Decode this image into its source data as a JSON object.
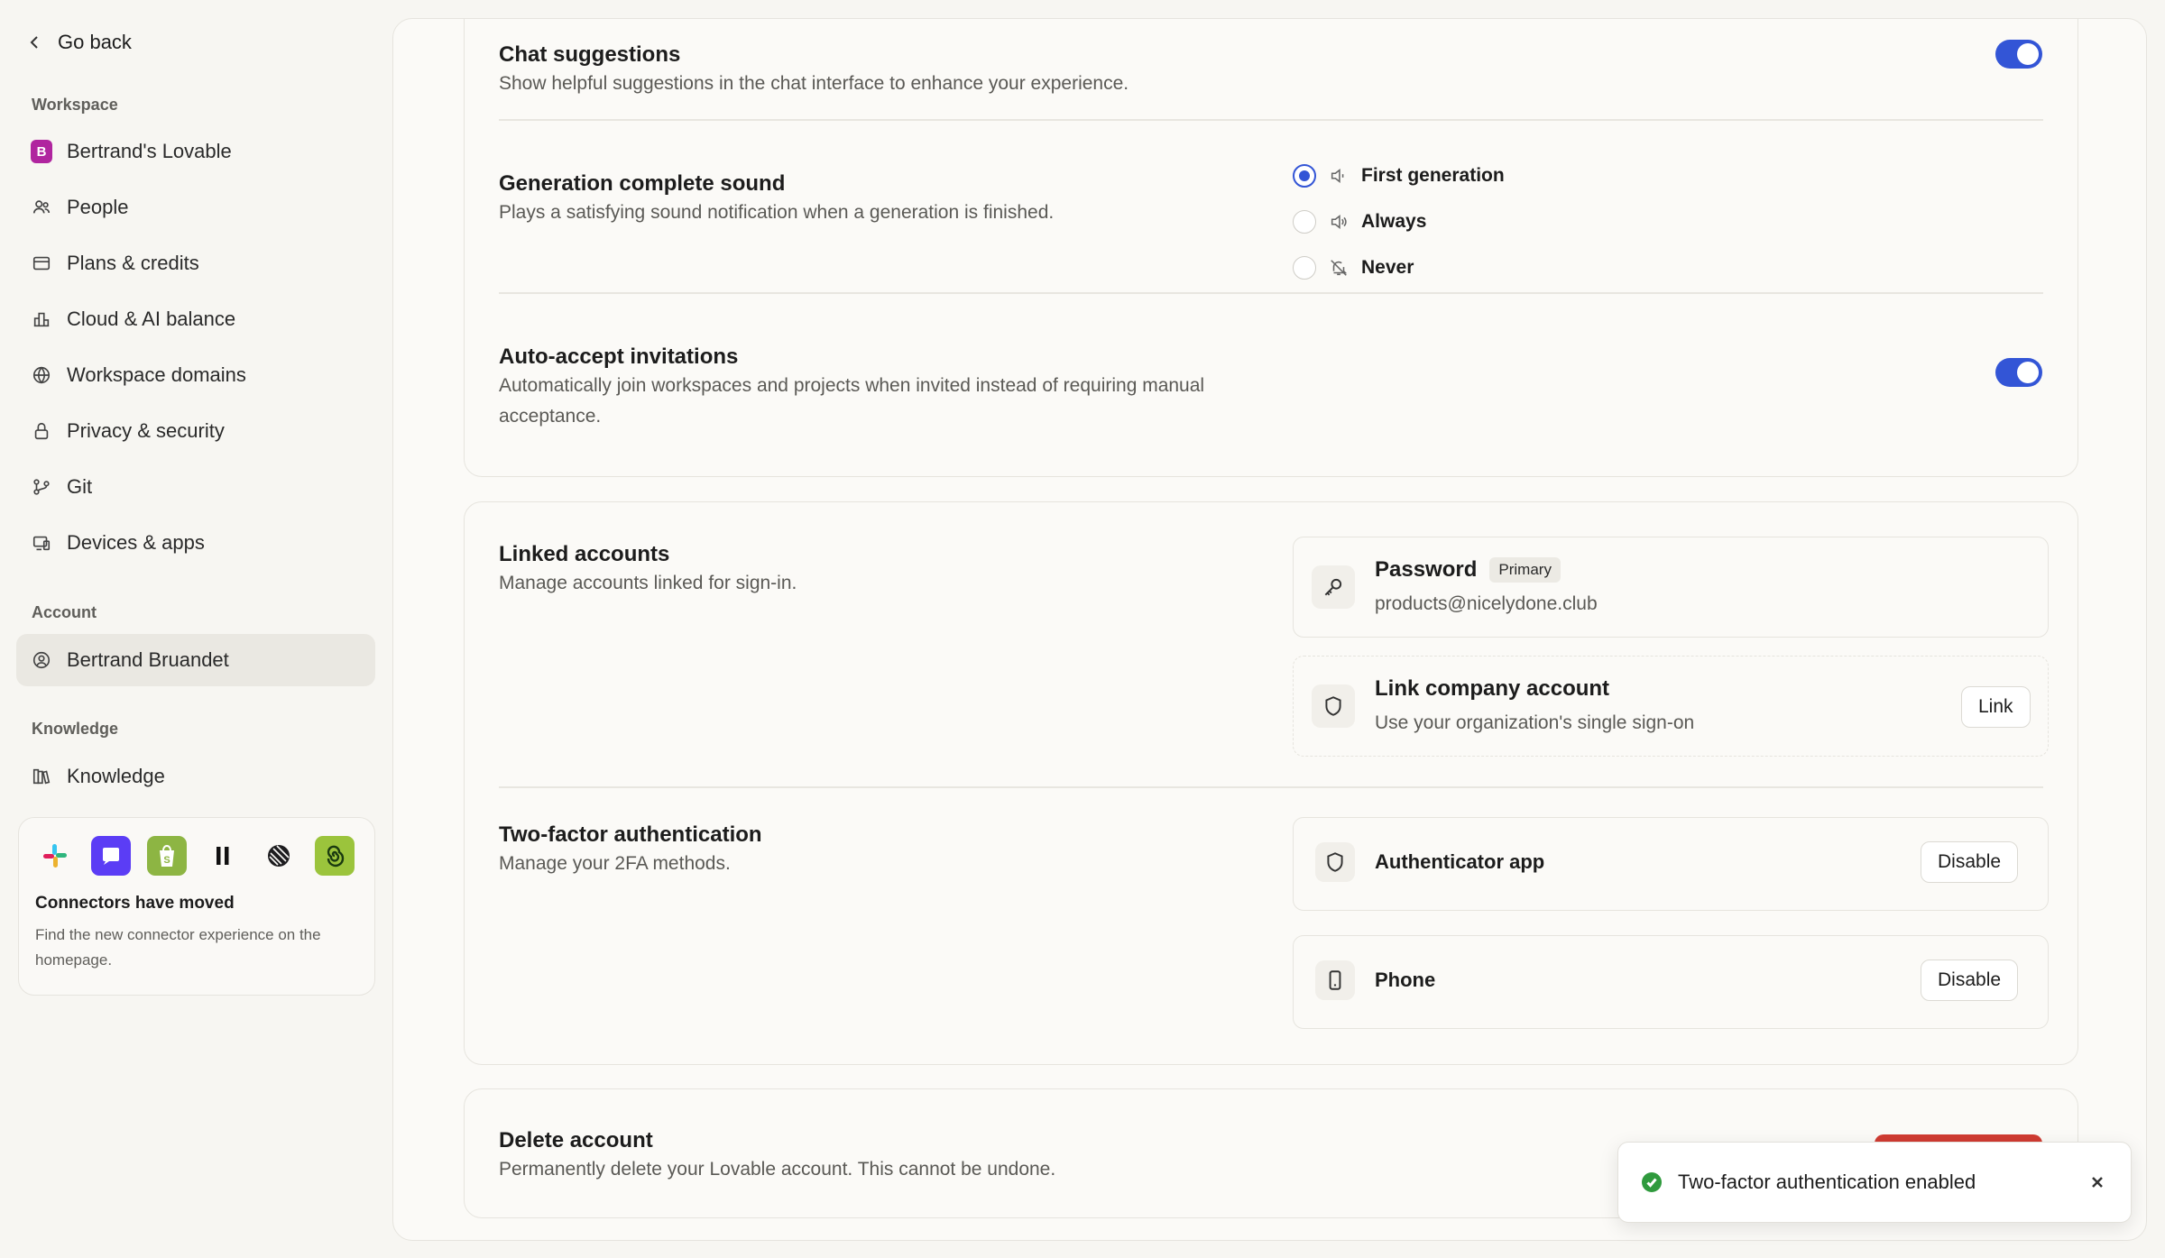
{
  "sidebar": {
    "go_back": "Go back",
    "workspace_label": "Workspace",
    "workspace_badge": "B",
    "workspace_items": [
      {
        "label": "Bertrand's Lovable",
        "icon": "workspace-badge"
      },
      {
        "label": "People",
        "icon": "people-icon"
      },
      {
        "label": "Plans & credits",
        "icon": "credit-card-icon"
      },
      {
        "label": "Cloud & AI balance",
        "icon": "bar-chart-icon"
      },
      {
        "label": "Workspace domains",
        "icon": "globe-icon"
      },
      {
        "label": "Privacy & security",
        "icon": "lock-icon"
      },
      {
        "label": "Git",
        "icon": "git-icon"
      },
      {
        "label": "Devices & apps",
        "icon": "devices-icon"
      }
    ],
    "account_label": "Account",
    "account_item": "Bertrand Bruandet",
    "knowledge_label": "Knowledge",
    "knowledge_item": "Knowledge",
    "connectors": {
      "title": "Connectors have moved",
      "description": "Find the new connector experience on the homepage."
    }
  },
  "settings": {
    "chat_suggestions": {
      "title": "Chat suggestions",
      "description": "Show helpful suggestions in the chat interface to enhance your experience.",
      "enabled": true
    },
    "generation_sound": {
      "title": "Generation complete sound",
      "description": "Plays a satisfying sound notification when a generation is finished.",
      "options": [
        "First generation",
        "Always",
        "Never"
      ],
      "selected": "First generation"
    },
    "auto_accept": {
      "title": "Auto-accept invitations",
      "description": "Automatically join workspaces and projects when invited instead of requiring manual acceptance.",
      "enabled": true
    },
    "linked_accounts": {
      "title": "Linked accounts",
      "description": "Manage accounts linked for sign-in.",
      "password": {
        "title": "Password",
        "badge": "Primary",
        "email": "products@nicelydone.club"
      },
      "company": {
        "title": "Link company account",
        "description": "Use your organization's single sign-on",
        "button": "Link"
      }
    },
    "two_factor": {
      "title": "Two-factor authentication",
      "description": "Manage your 2FA methods.",
      "methods": [
        {
          "label": "Authenticator app",
          "button": "Disable"
        },
        {
          "label": "Phone",
          "button": "Disable"
        }
      ]
    },
    "delete_account": {
      "title": "Delete account",
      "description": "Permanently delete your Lovable account. This cannot be undone."
    }
  },
  "toast": {
    "message": "Two-factor authentication enabled"
  },
  "colors": {
    "accent": "#3355d6",
    "danger": "#d03b32",
    "success": "#2f9a3d",
    "workspace_badge": "#b0259f"
  }
}
